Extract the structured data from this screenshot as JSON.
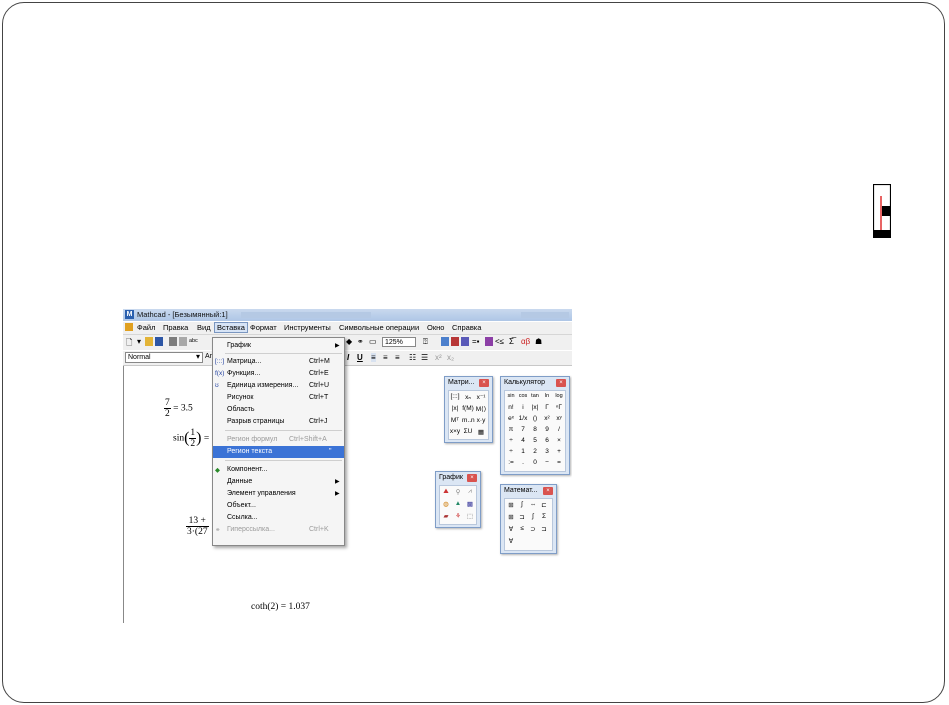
{
  "window": {
    "title": "Mathcad - [Безымянный:1]"
  },
  "menu": {
    "items": [
      "Файл",
      "Правка",
      "Вид",
      "Вставка",
      "Формат",
      "Инструменты",
      "Символьные операции",
      "Окно",
      "Справка"
    ],
    "active": "Вставка"
  },
  "toolbar": {
    "zoom": "125%",
    "style": "Normal",
    "font_prefix": "Ar"
  },
  "insert_menu": {
    "items": [
      {
        "label": "График",
        "shortcut": "",
        "submenu": true,
        "icon": "",
        "state": "normal"
      },
      {
        "label": "Матрица...",
        "shortcut": "Ctrl+M",
        "submenu": false,
        "icon": "[:::]",
        "state": "normal"
      },
      {
        "label": "Функция...",
        "shortcut": "Ctrl+E",
        "submenu": false,
        "icon": "f(x)",
        "state": "normal"
      },
      {
        "label": "Единица измерения...",
        "shortcut": "Ctrl+U",
        "submenu": false,
        "icon": "ʊ",
        "state": "normal"
      },
      {
        "label": "Рисунок",
        "shortcut": "Ctrl+T",
        "submenu": false,
        "icon": "",
        "state": "normal"
      },
      {
        "label": "Область",
        "shortcut": "",
        "submenu": false,
        "icon": "",
        "state": "normal"
      },
      {
        "label": "Разрыв страницы",
        "shortcut": "Ctrl+J",
        "submenu": false,
        "icon": "",
        "state": "normal"
      },
      {
        "label": "Регион формул",
        "shortcut": "Ctrl+Shift+A",
        "submenu": false,
        "icon": "",
        "state": "disabled"
      },
      {
        "label": "Регион текста",
        "shortcut": "\"",
        "submenu": false,
        "icon": "",
        "state": "highlighted"
      },
      {
        "label": "Компонент...",
        "shortcut": "",
        "submenu": false,
        "icon": "◆",
        "state": "normal"
      },
      {
        "label": "Данные",
        "shortcut": "",
        "submenu": true,
        "icon": "",
        "state": "normal"
      },
      {
        "label": "Элемент управления",
        "shortcut": "",
        "submenu": true,
        "icon": "",
        "state": "normal"
      },
      {
        "label": "Объект...",
        "shortcut": "",
        "submenu": false,
        "icon": "",
        "state": "normal"
      },
      {
        "label": "Ссылка...",
        "shortcut": "",
        "submenu": false,
        "icon": "",
        "state": "normal"
      },
      {
        "label": "Гиперссылка...",
        "shortcut": "Ctrl+K",
        "submenu": false,
        "icon": "⚭",
        "state": "disabled"
      }
    ]
  },
  "worksheet": {
    "expr1": {
      "num": "7",
      "den": "2",
      "result": "= 3.5"
    },
    "expr2": {
      "fn": "sin",
      "num": "1",
      "den": "2",
      "tail": "="
    },
    "expr3": {
      "num": "13 +",
      "den": "3·(27"
    },
    "expr4": "coth(2) = 1.037"
  },
  "palettes": {
    "matrix": {
      "title": "Матри...",
      "cells": [
        "[:::]",
        "xₙ",
        "x⁻¹",
        "|x|",
        "f(M)",
        "M⟨⟩",
        "Mᵀ",
        "m..n",
        "x·y",
        "x×y",
        "ΣU",
        "▦"
      ]
    },
    "calculator": {
      "title": "Калькулятор",
      "cells": [
        "sin",
        "cos",
        "tan",
        "ln",
        "log",
        "n!",
        "i",
        "|x|",
        "Γ",
        "ⁿΓ",
        "eˣ",
        "1/x",
        "()",
        "x²",
        "xʸ",
        "π",
        "7",
        "8",
        "9",
        "/",
        "÷",
        "4",
        "5",
        "6",
        "×",
        "÷",
        "1",
        "2",
        "3",
        "+",
        ":=",
        ".",
        "0",
        "−",
        "="
      ]
    },
    "graph": {
      "title": "График",
      "cells": [
        "⛰",
        "⚲",
        "⩘",
        "◍",
        "▲",
        "▩",
        "▰",
        "⚘",
        "⬚"
      ]
    },
    "math": {
      "title": "Математ...",
      "cells": [
        "⊞",
        "∫",
        "⇔",
        "⊏",
        "⊞",
        "⊐",
        "∫",
        "Σ",
        "∀",
        "≤",
        "⊃",
        "⊐",
        "∀"
      ]
    }
  },
  "colors": {
    "highlight": "#3b73d6",
    "palette_bg": "#dbe6f4",
    "close_red": "#d9534f"
  }
}
